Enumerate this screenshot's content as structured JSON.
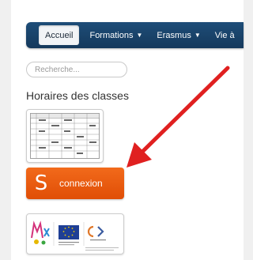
{
  "nav": {
    "items": [
      {
        "label": "Accueil",
        "active": true
      },
      {
        "label": "Formations",
        "dropdown": true
      },
      {
        "label": "Erasmus",
        "dropdown": true
      },
      {
        "label": "Vie à"
      }
    ]
  },
  "search": {
    "placeholder": "Recherche..."
  },
  "sidebar": {
    "heading": "Horaires des classes",
    "connexion": {
      "letter": "S",
      "label": "connexion"
    }
  },
  "colors": {
    "nav_bg": "#1e4d78",
    "connexion_bg": "#f26a1b",
    "arrow": "#e02020"
  },
  "icons": {
    "caret": "caret-down-icon",
    "arrow": "red-arrow-icon"
  }
}
